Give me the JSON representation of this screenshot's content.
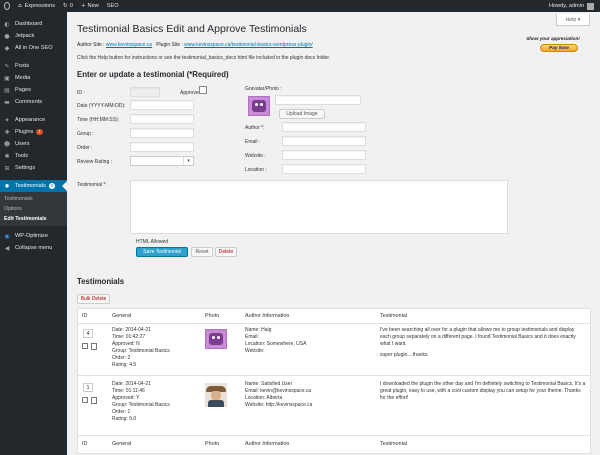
{
  "adminbar": {
    "site_name": "Expressions",
    "updates_count": "0",
    "new_label": "New",
    "seo_label": "SEO",
    "howdy": "Howdy, admin"
  },
  "sidebar": {
    "items": [
      {
        "label": "Dashboard",
        "icon": "dashboard-icon"
      },
      {
        "label": "Jetpack",
        "icon": "jetpack-icon"
      },
      {
        "label": "All in One SEO",
        "icon": "seo-icon"
      },
      {
        "label": "Posts",
        "icon": "pin-icon"
      },
      {
        "label": "Media",
        "icon": "media-icon"
      },
      {
        "label": "Pages",
        "icon": "page-icon"
      },
      {
        "label": "Comments",
        "icon": "comment-icon"
      },
      {
        "label": "Appearance",
        "icon": "brush-icon"
      },
      {
        "label": "Plugins",
        "icon": "plugin-icon",
        "count": "1"
      },
      {
        "label": "Users",
        "icon": "user-icon"
      },
      {
        "label": "Tools",
        "icon": "wrench-icon"
      },
      {
        "label": "Settings",
        "icon": "settings-icon"
      },
      {
        "label": "Testimonials",
        "icon": "gear-icon",
        "count": "2"
      }
    ],
    "submenu": [
      "Testimonials",
      "Options",
      "Edit Testimonials"
    ],
    "after": [
      {
        "label": "WP-Optimize",
        "icon": "optimize-icon"
      },
      {
        "label": "Collapse menu",
        "icon": "collapse-icon"
      }
    ]
  },
  "help_tab": "Help ▾",
  "page_title": "Testimonial Basics Edit and Approve Testimonials",
  "appreciation": "Show your appreciation!",
  "paynow": "Pay Now",
  "sites": {
    "author_label": "Author Site :",
    "author_url": "www.kevinsspace.ca",
    "plugin_label": "Plugin Site :",
    "plugin_url": "www.kevinsspace.ca/testimonial-basics-wordpress-plugin/"
  },
  "help_line": "Click the Help button for instructions or see the testimonial_basics_docs html file included in the plugin docs folder.",
  "form": {
    "heading": "Enter or update a testimonial (*Required)",
    "labels": {
      "id": "ID :",
      "approved": "Approved :",
      "date": "Date (YYYY-MM-DD):",
      "time": "Time (HH:MM:SS):",
      "group": "Group :",
      "order": "Order :",
      "rating": "Review Rating :",
      "gravatar": "Gravatar/Photo :",
      "author": "Author *:",
      "email": "Email :",
      "website": "Website :",
      "location": "Location :",
      "testimonial": "Testimonial *:"
    },
    "upload_image": "Upload Image",
    "html_allowed": "HTML Allowed",
    "save": "Save Testimonial",
    "reset": "Reset",
    "delete": "Delete"
  },
  "list": {
    "heading": "Testimonials",
    "bulk_delete": "Bulk Delete",
    "columns": [
      "ID",
      "General",
      "Photo",
      "Author Information",
      "Testimonial"
    ],
    "rows": [
      {
        "order": "4",
        "general": [
          "Date: 2014-04-21",
          "Time: 01:42:27",
          "Approved: N",
          "Group: Testimonial Basics",
          "Order: 2",
          "Rating: 4.5"
        ],
        "author": [
          "Name: Haig",
          "Email:",
          "Location: Somewhere, USA",
          "Website:"
        ],
        "testimonial": [
          "I've been searching all over for a plugin that allows me to group testimonials and display each group separately on a different page. I found Testimonial Basics and it does exactly what I want.",
          "super plugin....thanks."
        ],
        "photo": "purple-monster"
      },
      {
        "order": "1",
        "general": [
          "Date: 2014-04-21",
          "Time: 01:11:46",
          "Approved: Y",
          "Group: Testimonial Basics",
          "Order: 1",
          "Rating: 5.0"
        ],
        "author": [
          "Name: Satisfied User",
          "Email: kevin@kevinsspace.ca",
          "Location: Alberta",
          "Website: http://kevinsspace.ca"
        ],
        "testimonial": [
          "I downloaded the plugin the other day and I'm definitely switching to Testimonial Basics, It's a great plugin, easy to use, with a cool custom display you can setup for your theme. Thanks for the effort!"
        ],
        "photo": "cowboy"
      }
    ]
  }
}
